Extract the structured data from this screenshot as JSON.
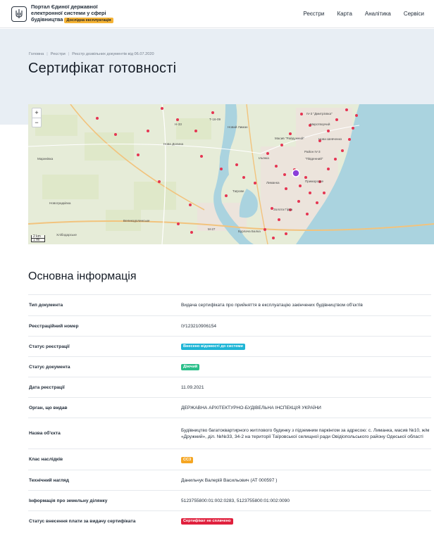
{
  "header": {
    "logo_line1": "Портал Єдиної державної",
    "logo_line2": "електронної системи у сфері",
    "logo_line3": "будівництва",
    "beta": "Дослідна експлуатація",
    "nav": [
      "Реєстри",
      "Карта",
      "Аналітика",
      "Сервіси"
    ]
  },
  "breadcrumb": [
    "Головна",
    "Реєстри",
    "Реєстр дозвільних документів від 06.07.2020"
  ],
  "page_title": "Сертифікат готовності",
  "map": {
    "zoom_in": "+",
    "zoom_out": "−",
    "scale_km": "2 km",
    "scale_mi": "1 mi",
    "labels": [
      {
        "text": "Т-16-09"
      },
      {
        "text": "Н-33"
      },
      {
        "text": "Нова Долина"
      },
      {
        "text": "Маринівка"
      },
      {
        "text": "Новоградківка"
      },
      {
        "text": "Хлібодарське"
      },
      {
        "text": "Великодолинське"
      },
      {
        "text": "Новий Лиман"
      },
      {
        "text": "Масив \"Райдужний\""
      },
      {
        "text": "IV-3 \"Дмитрієвка\""
      },
      {
        "text": "Миротворчий"
      },
      {
        "text": "Нова Шевченко"
      },
      {
        "text": "Район IV-3"
      },
      {
        "text": "\"Південний\""
      },
      {
        "text": "Ільїнка"
      },
      {
        "text": "Лиманка"
      },
      {
        "text": "Приморське"
      },
      {
        "text": "Таїрове"
      },
      {
        "text": "Золота Гірка"
      },
      {
        "text": "Бурлача Балка"
      },
      {
        "text": "М-27"
      }
    ]
  },
  "main_info": {
    "title": "Основна інформація",
    "rows": [
      {
        "label": "Тип документа",
        "value": "Видача сертифіката про прийняття в експлуатацію закінчених будівництвом об'єктів"
      },
      {
        "label": "Реєстраційний номер",
        "value": "ІУ123210906154"
      },
      {
        "label": "Статус реєстрації",
        "badge": "Внесено відомості до системи",
        "badge_color": "#1fb5d6"
      },
      {
        "label": "Статус документа",
        "badge": "Діючий",
        "badge_color": "#2bbf8a"
      },
      {
        "label": "Дата реєстрації",
        "value": "11.09.2021"
      },
      {
        "label": "Орган, що видав",
        "value": "ДЕРЖАВНА АРХІТЕКТУРНО-БУДІВЕЛЬНА ІНСПЕКЦІЯ УКРАЇНИ"
      },
      {
        "label": "Назва об'єкта",
        "value": "Будівництво багатоквартирного житлового будинку з підземним паркінгом за адресою: с. Лиманка, масив №10, ж/м «Дружний», діл. №№33, 34-2 на території Таїровської селищної ради Овідіопольського району Одеської області"
      },
      {
        "label": "Клас наслідків",
        "badge": "СС3",
        "badge_color": "#f5a623"
      },
      {
        "label": "Технічний нагляд",
        "value": "Данильчук Валерій Васильович (АТ 000597 )"
      },
      {
        "label": "Інформація про земельну ділянку",
        "value": "5123755800:01:002:0283, 5123755800:01:002:0090"
      },
      {
        "label": "Статус внесення плати за видачу сертифіката",
        "badge": "Сертифікат не сплачено",
        "badge_color": "#e0203d"
      }
    ]
  }
}
